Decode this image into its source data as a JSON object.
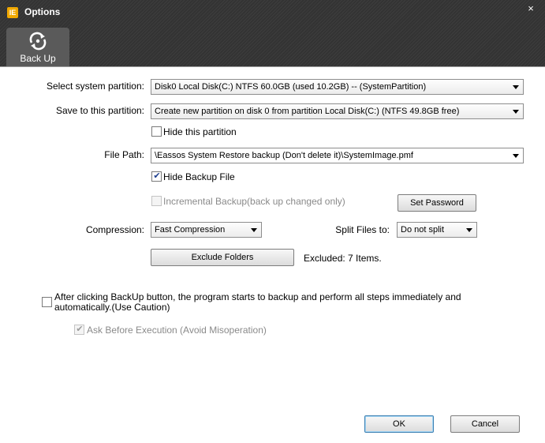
{
  "window": {
    "title": "Options",
    "logo_text": "IE",
    "close_glyph": "×"
  },
  "tabs": [
    {
      "label": "Back Up",
      "icon": "backup-icon"
    }
  ],
  "form": {
    "system_partition": {
      "label": "Select system partition:",
      "value": "Disk0  Local Disk(C:) NTFS 60.0GB (used 10.2GB) -- (SystemPartition)"
    },
    "save_partition": {
      "label": "Save to this partition:",
      "value": "Create new partition on disk 0 from partition Local Disk(C:) (NTFS 49.8GB free)"
    },
    "hide_partition": {
      "label": "Hide this partition",
      "checked": false
    },
    "file_path": {
      "label": "File Path:",
      "value": "\\Eassos System Restore backup (Don't delete it)\\SystemImage.pmf"
    },
    "hide_backup_file": {
      "label": "Hide Backup File",
      "checked": true
    },
    "incremental_backup": {
      "label": "Incremental Backup(back up changed only)",
      "checked": false,
      "enabled": false
    },
    "set_password_label": "Set Password",
    "compression": {
      "label": "Compression:",
      "value": "Fast Compression"
    },
    "split_files": {
      "label": "Split Files to:",
      "value": "Do not split"
    },
    "exclude_folders_label": "Exclude Folders",
    "excluded_text": "Excluded: 7 Items.",
    "auto_start": {
      "label_line1": "After clicking BackUp button, the program starts to backup and perform all steps immediately and",
      "label_line2": "automatically.(Use Caution)",
      "checked": false
    },
    "ask_before": {
      "label": "Ask Before Execution (Avoid Misoperation)",
      "checked": true,
      "enabled": false
    }
  },
  "footer": {
    "ok_label": "OK",
    "cancel_label": "Cancel"
  },
  "colors": {
    "titlebar": "#333333",
    "tab": "#5a5a5a",
    "check_mark": "#1c3d8e"
  }
}
